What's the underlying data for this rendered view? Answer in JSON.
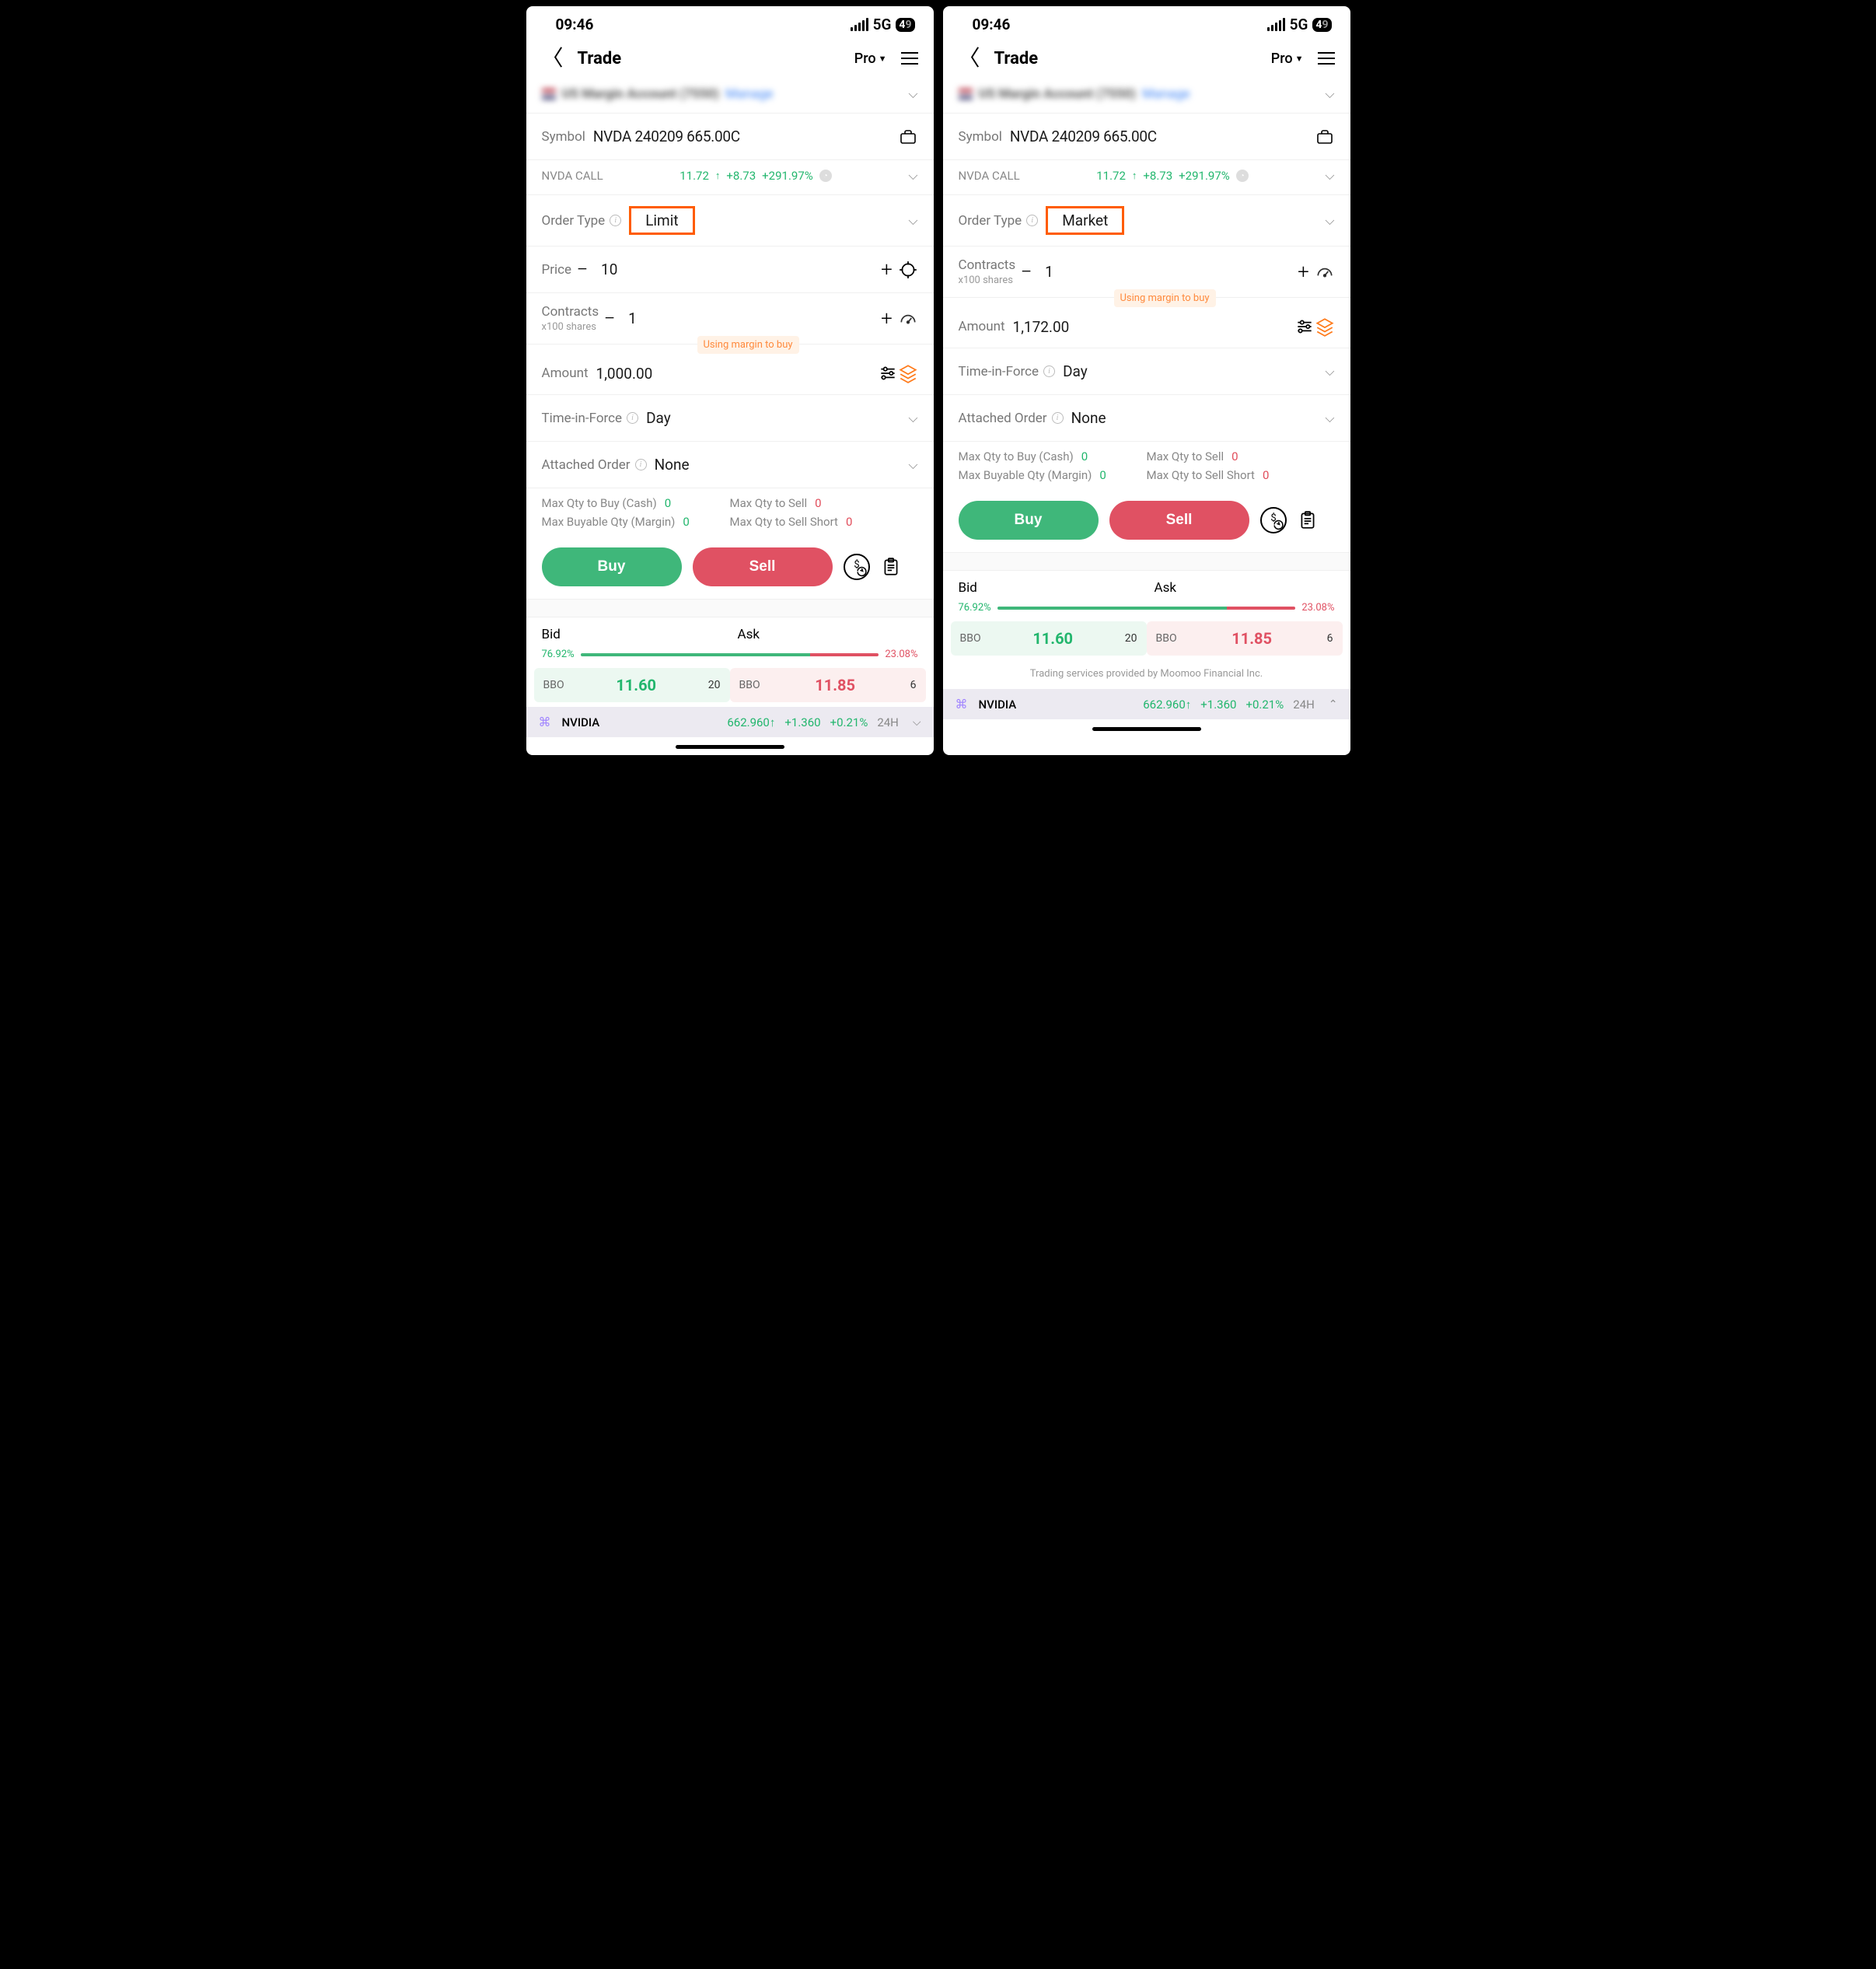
{
  "status": {
    "time": "09:46",
    "network": "5G",
    "battery_a": "4",
    "battery_b": "9"
  },
  "nav": {
    "title": "Trade",
    "pro": "Pro"
  },
  "account": {
    "name": "US Margin Account (7550)",
    "link": "Manage"
  },
  "symbol": {
    "label": "Symbol",
    "value": "NVDA 240209 665.00C"
  },
  "quote": {
    "name": "NVDA CALL",
    "price": "11.72",
    "change_abs": "+8.73",
    "change_pct": "+291.97%"
  },
  "order_type": {
    "label": "Order Type",
    "left_value": "Limit",
    "right_value": "Market"
  },
  "price": {
    "label": "Price",
    "value": "10"
  },
  "contracts": {
    "label": "Contracts",
    "sub": "x100 shares",
    "left_value": "1",
    "right_value": "1",
    "margin_badge": "Using margin to buy"
  },
  "amount": {
    "label": "Amount",
    "left_value": "1,000.00",
    "right_value": "1,172.00"
  },
  "tif": {
    "label": "Time-in-Force",
    "value": "Day"
  },
  "attached": {
    "label": "Attached Order",
    "value": "None"
  },
  "qty": {
    "buy_cash_label": "Max Qty to Buy (Cash)",
    "buy_cash_val": "0",
    "buy_margin_label": "Max Buyable Qty (Margin)",
    "buy_margin_val": "0",
    "sell_label": "Max Qty to Sell",
    "sell_val": "0",
    "sell_short_label": "Max Qty to Sell Short",
    "sell_short_val": "0"
  },
  "actions": {
    "buy": "Buy",
    "sell": "Sell"
  },
  "bidask": {
    "bid_label": "Bid",
    "ask_label": "Ask",
    "bid_pct": "76.92%",
    "ask_pct": "23.08%",
    "bbo": "BBO",
    "bid_price": "11.60",
    "bid_qty": "20",
    "ask_price": "11.85",
    "ask_qty": "6"
  },
  "ticker": {
    "name": "NVIDIA",
    "price": "662.960",
    "change_abs": "+1.360",
    "change_pct": "+0.21%",
    "period": "24H"
  },
  "disclaimer": "Trading services provided by Moomoo Financial Inc."
}
